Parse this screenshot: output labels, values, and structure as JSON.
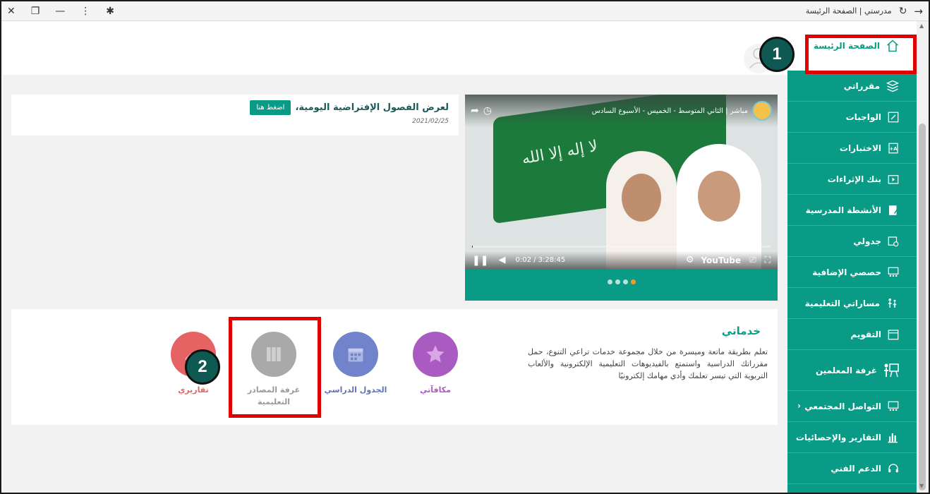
{
  "browser": {
    "tab_title": "مدرستي | الصفحة الرئيسة"
  },
  "sidebar": {
    "items": [
      {
        "label": "الصفحة الرئيسة",
        "icon": "home-icon"
      },
      {
        "label": "مقرراتي",
        "icon": "books-icon"
      },
      {
        "label": "الواجبات",
        "icon": "edit-icon"
      },
      {
        "label": "الاختبارات",
        "icon": "exam-icon"
      },
      {
        "label": "بنك الإثراءات",
        "icon": "video-icon"
      },
      {
        "label": "الأنشطة المدرسية",
        "icon": "activity-icon"
      },
      {
        "label": "جدولي",
        "icon": "calendar-clock-icon"
      },
      {
        "label": "حصصي الإضافية",
        "icon": "classes-icon"
      },
      {
        "label": "مساراتي التعليمية",
        "icon": "paths-icon"
      },
      {
        "label": "التقويم",
        "icon": "calendar-icon"
      },
      {
        "label": "غرفة المعلمين",
        "icon": "teachers-room-icon"
      },
      {
        "label": "التواصل المجتمعي",
        "icon": "community-icon"
      },
      {
        "label": "التقارير والإحصائيات",
        "icon": "reports-icon"
      },
      {
        "label": "الدعم الفني",
        "icon": "headset-icon"
      }
    ]
  },
  "news": {
    "text": "لعرض الفصول الإفتراضية اليومية،",
    "button_label": "اضغط هنا",
    "date": "2021/02/25"
  },
  "video": {
    "title": "مباشر | الثاني المتوسط - الخميس - الأسبوع السادس",
    "time": "0:02 / 3:28:45",
    "brand": "YouTube",
    "flag_text": "لا إله إلا الله"
  },
  "services": {
    "title": "خدماتي",
    "description": "تعلم بطريقة ماتعة وميسرة من خلال مجموعة خدمات تراعي التنوع، حمل مقرراتك الدراسية واستمتع بالفيديوهات التعليمية الإلكترونية والألعاب التربوية التي تيسر تعلمك وأدي مهامك إلكترونيًا",
    "items": [
      {
        "label": "مكافآتي",
        "color": "#a95bc1"
      },
      {
        "label": "الجدول الدراسي",
        "color": "#7184cb"
      },
      {
        "label": "غرفة المصادر التعليمية",
        "color": "#a9a9aa"
      },
      {
        "label": "تقاريري",
        "color": "#e66363"
      }
    ]
  },
  "annotations": {
    "step1": "1",
    "step2": "2"
  },
  "colors": {
    "primary": "#0a9b86",
    "highlight": "#e00000",
    "badge": "#0e5a52"
  }
}
